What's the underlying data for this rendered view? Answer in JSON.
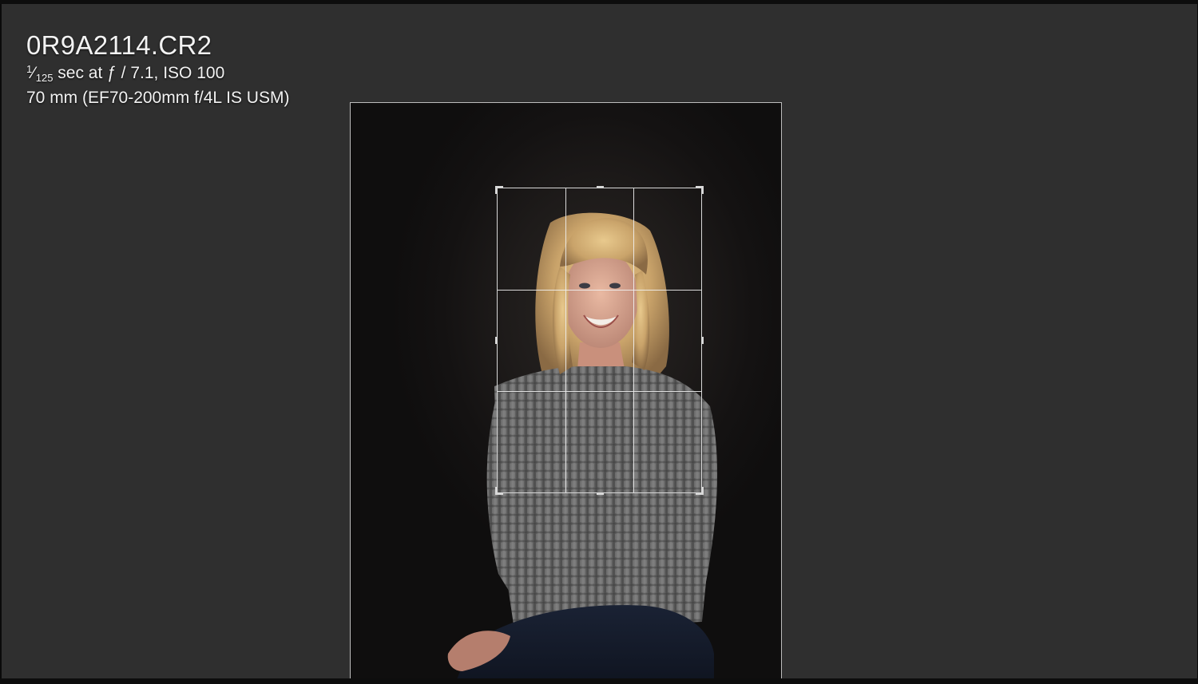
{
  "image_info": {
    "filename": "0R9A2114.CR2",
    "shutter_numerator": "1",
    "shutter_denominator": "125",
    "exposure_rest": " sec at ƒ / 7.1, ISO 100",
    "lens": "70 mm (EF70-200mm f/4L IS USM)"
  },
  "crop_overlay": {
    "grid": "thirds",
    "handles": [
      "top-left",
      "top",
      "top-right",
      "left",
      "right",
      "bottom-left",
      "bottom",
      "bottom-right"
    ]
  },
  "colors": {
    "workspace_background": "#2f2f2f",
    "crop_lines": "#d8d8d8"
  }
}
